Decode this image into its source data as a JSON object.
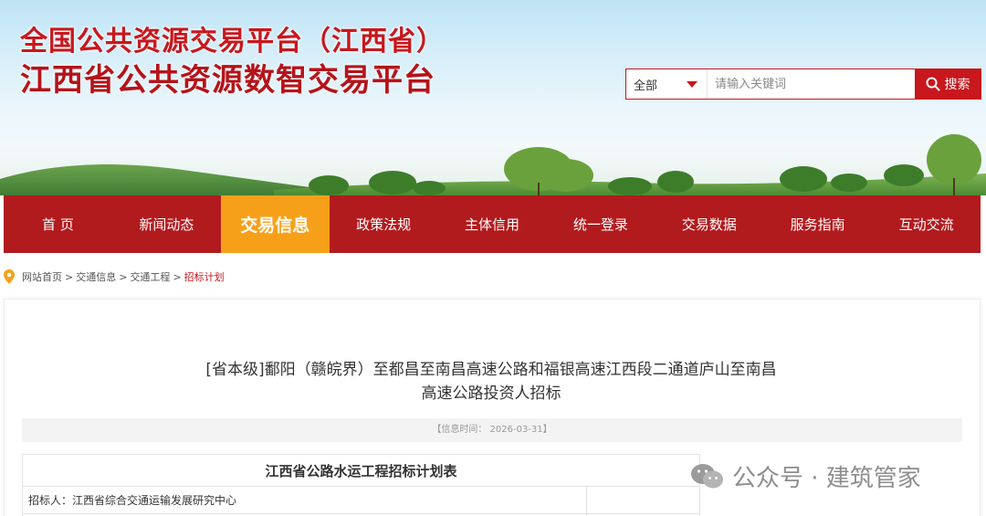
{
  "header": {
    "title_line1": "全国公共资源交易平台（江西省）",
    "title_line2": "江西省公共资源数智交易平台",
    "brand_red": "#c8171d"
  },
  "search": {
    "category_selected": "全部",
    "placeholder": "请输入关键词",
    "button_label": "搜索"
  },
  "nav": {
    "items": [
      {
        "label": "首 页"
      },
      {
        "label": "新闻动态"
      },
      {
        "label": "交易信息"
      },
      {
        "label": "政策法规"
      },
      {
        "label": "主体信用"
      },
      {
        "label": "统一登录"
      },
      {
        "label": "交易数据"
      },
      {
        "label": "服务指南"
      },
      {
        "label": "互动交流"
      }
    ],
    "active_index": 2,
    "bar_color": "#b21b1e",
    "active_color": "#f6a01a"
  },
  "breadcrumb": {
    "items": [
      "网站首页",
      "交通信息",
      "交通工程",
      "招标计划"
    ],
    "separator": ">"
  },
  "article": {
    "title_line1": "[省本级]鄱阳（赣皖界）至都昌至南昌高速公路和福银高速江西段二通道庐山至南昌",
    "title_line2": "高速公路投资人招标",
    "meta": "【信息时间： 2026-03-31】"
  },
  "table": {
    "heading": "江西省公路水运工程招标计划表",
    "tenderer": "招标人：江西省综合交通运输发展研究中心"
  },
  "watermark": {
    "text": "公众号 · 建筑管家",
    "icon": "wechat-icon"
  }
}
